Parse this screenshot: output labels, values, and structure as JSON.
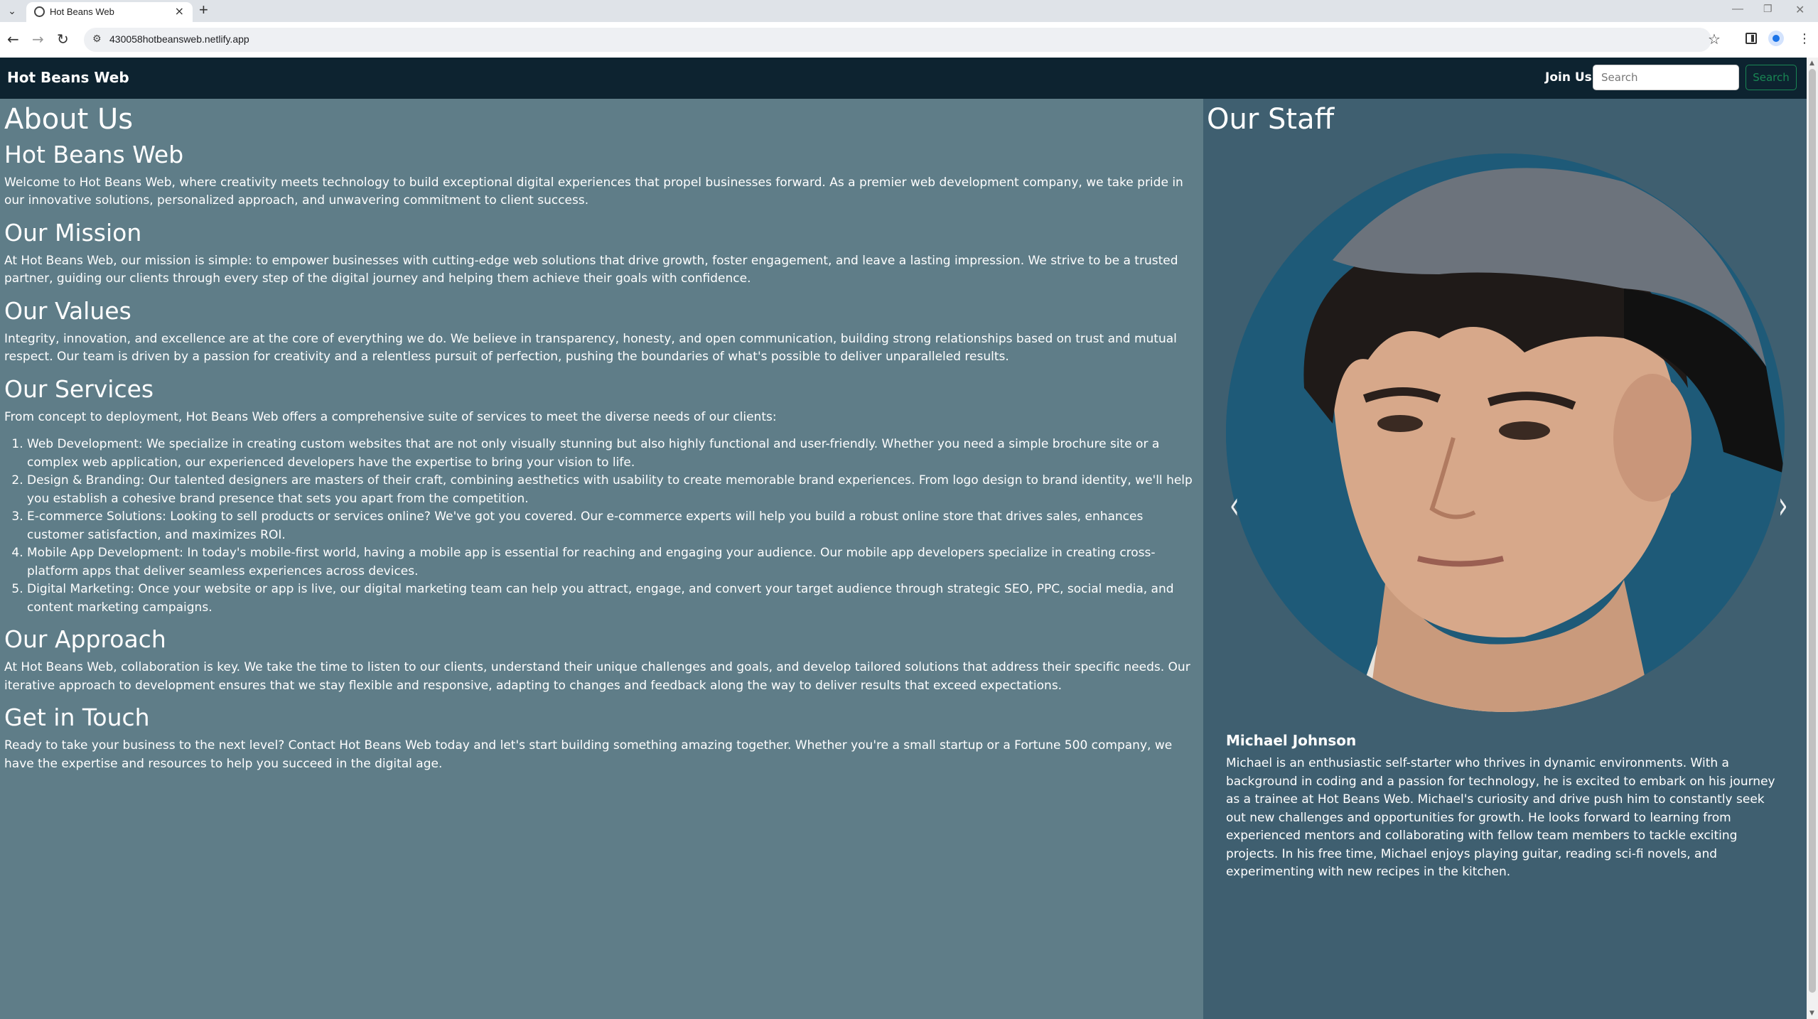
{
  "browser": {
    "tab_title": "Hot Beans Web",
    "url": "430058hotbeansweb.netlify.app"
  },
  "navbar": {
    "brand": "Hot Beans Web",
    "join_label": "Join Us",
    "search_placeholder": "Search",
    "search_button": "Search"
  },
  "about": {
    "title": "About Us",
    "company_heading": "Hot Beans Web",
    "company_text": "Welcome to Hot Beans Web, where creativity meets technology to build exceptional digital experiences that propel businesses forward. As a premier web development company, we take pride in our innovative solutions, personalized approach, and unwavering commitment to client success.",
    "mission_heading": "Our Mission",
    "mission_text": "At Hot Beans Web, our mission is simple: to empower businesses with cutting-edge web solutions that drive growth, foster engagement, and leave a lasting impression. We strive to be a trusted partner, guiding our clients through every step of the digital journey and helping them achieve their goals with confidence.",
    "values_heading": "Our Values",
    "values_text": "Integrity, innovation, and excellence are at the core of everything we do. We believe in transparency, honesty, and open communication, building strong relationships based on trust and mutual respect. Our team is driven by a passion for creativity and a relentless pursuit of perfection, pushing the boundaries of what's possible to deliver unparalleled results.",
    "services_heading": "Our Services",
    "services_intro": "From concept to deployment, Hot Beans Web offers a comprehensive suite of services to meet the diverse needs of our clients:",
    "services": [
      "Web Development: We specialize in creating custom websites that are not only visually stunning but also highly functional and user-friendly. Whether you need a simple brochure site or a complex web application, our experienced developers have the expertise to bring your vision to life.",
      "Design & Branding: Our talented designers are masters of their craft, combining aesthetics with usability to create memorable brand experiences. From logo design to brand identity, we'll help you establish a cohesive brand presence that sets you apart from the competition.",
      "E-commerce Solutions: Looking to sell products or services online? We've got you covered. Our e-commerce experts will help you build a robust online store that drives sales, enhances customer satisfaction, and maximizes ROI.",
      "Mobile App Development: In today's mobile-first world, having a mobile app is essential for reaching and engaging your audience. Our mobile app developers specialize in creating cross-platform apps that deliver seamless experiences across devices.",
      "Digital Marketing: Once your website or app is live, our digital marketing team can help you attract, engage, and convert your target audience through strategic SEO, PPC, social media, and content marketing campaigns."
    ],
    "approach_heading": "Our Approach",
    "approach_text": "At Hot Beans Web, collaboration is key. We take the time to listen to our clients, understand their unique challenges and goals, and develop tailored solutions that address their specific needs. Our iterative approach to development ensures that we stay flexible and responsive, adapting to changes and feedback along the way to deliver results that exceed expectations.",
    "contact_heading": "Get in Touch",
    "contact_text": "Ready to take your business to the next level? Contact Hot Beans Web today and let's start building something amazing together. Whether you're a small startup or a Fortune 500 company, we have the expertise and resources to help you succeed in the digital age."
  },
  "staff": {
    "title": "Our Staff",
    "prev_icon": "chevron-left-icon",
    "next_icon": "chevron-right-icon",
    "current": {
      "name": "Michael Johnson",
      "bio": "Michael is an enthusiastic self-starter who thrives in dynamic environments. With a background in coding and a passion for technology, he is excited to embark on his journey as a trainee at Hot Beans Web. Michael's curiosity and drive push him to constantly seek out new challenges and opportunities for growth. He looks forward to learning from experienced mentors and collaborating with fellow team members to tackle exciting projects. In his free time, Michael enjoys playing guitar, reading sci-fi novels, and experimenting with new recipes in the kitchen."
    }
  },
  "colors": {
    "navbar_bg": "#0d2330",
    "left_panel_bg": "#5f7d88",
    "right_panel_bg": "#3f5f70",
    "search_button": "#198754"
  }
}
